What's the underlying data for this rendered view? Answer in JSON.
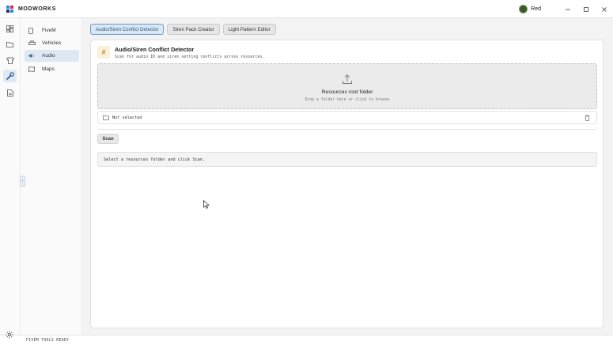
{
  "app": {
    "name": "MODWORKS",
    "brand_colors": [
      "#1f8fe0",
      "#e0245e",
      "#2a2a6a"
    ]
  },
  "user": {
    "name": "Red"
  },
  "window_controls": {
    "minimize": "minimize-icon",
    "maximize": "maximize-icon",
    "close": "close-icon"
  },
  "rail": {
    "items": [
      {
        "icon": "dashboard-icon"
      },
      {
        "icon": "folder-icon"
      },
      {
        "icon": "shirt-icon"
      },
      {
        "icon": "wrench-icon",
        "active": true
      },
      {
        "icon": "document-icon"
      }
    ]
  },
  "sidebar": {
    "items": [
      {
        "label": "FiveM",
        "icon": "phone-icon"
      },
      {
        "label": "Vehicles",
        "icon": "car-icon"
      },
      {
        "label": "Audio",
        "icon": "speaker-icon",
        "active": true
      },
      {
        "label": "Maps",
        "icon": "map-icon"
      }
    ]
  },
  "tabs": [
    {
      "label": "Audio/Siren Conflict Detector",
      "active": true
    },
    {
      "label": "Siren Pack Creator"
    },
    {
      "label": "Light Pattern Editor"
    }
  ],
  "tool": {
    "title": "Audio/Siren Conflict Detector",
    "subtitle": "Scan for audio ID and siren setting conflicts across resources.",
    "icon_glyph": "#"
  },
  "dropzone": {
    "title": "Resources root folder",
    "hint": "Drop a folder here or click to browse"
  },
  "folder": {
    "value": "Not selected"
  },
  "scan_button": {
    "label": "Scan"
  },
  "status": {
    "message": "Select a resources folder and click Scan."
  },
  "footer": {
    "status": "FIVEM TOOLS READY"
  },
  "accent_color": "#4a86c5"
}
